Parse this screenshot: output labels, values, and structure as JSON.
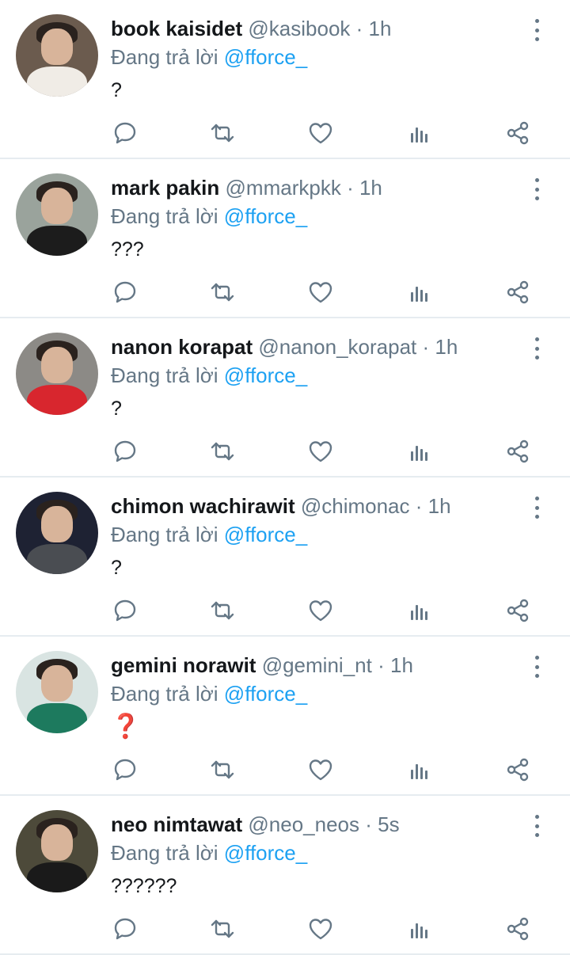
{
  "reply_prefix": "Đang trả lời",
  "tweets": [
    {
      "name": "book kaisidet",
      "handle": "@kasibook",
      "time": "1h",
      "reply_to": "@fforce_",
      "text": "?",
      "avatar_bg": "#6b5b4e",
      "avatar_body": "#f0ece6"
    },
    {
      "name": "mark pakin",
      "handle": "@mmarkpkk",
      "time": "1h",
      "reply_to": "@fforce_",
      "text": "???",
      "avatar_bg": "#9aa39c",
      "avatar_body": "#1c1c1c"
    },
    {
      "name": "nanon korapat",
      "handle": "@nanon_korapat",
      "time": "1h",
      "reply_to": "@fforce_",
      "text": "?",
      "avatar_bg": "#8c8a86",
      "avatar_body": "#d8262e"
    },
    {
      "name": "chimon wachirawit",
      "handle": "@chimonac",
      "time": "1h",
      "reply_to": "@fforce_",
      "text": "?",
      "avatar_bg": "#1e2233",
      "avatar_body": "#4a4d52"
    },
    {
      "name": "gemini norawit",
      "handle": "@gemini_nt",
      "time": "1h",
      "reply_to": "@fforce_",
      "text": "❓",
      "avatar_bg": "#d9e4e2",
      "avatar_body": "#1d7a5e"
    },
    {
      "name": "neo nimtawat",
      "handle": "@neo_neos",
      "time": "5s",
      "reply_to": "@fforce_",
      "text": "??????",
      "avatar_bg": "#4d4a3a",
      "avatar_body": "#1a1a1a"
    }
  ],
  "icons": {
    "reply": "reply-icon",
    "retweet": "retweet-icon",
    "like": "like-icon",
    "views": "views-icon",
    "share": "share-icon",
    "more": "more-vertical-icon"
  },
  "colors": {
    "name": "#14171a",
    "muted": "#657786",
    "mention": "#1da1f2",
    "divider": "#e6ecf0"
  }
}
